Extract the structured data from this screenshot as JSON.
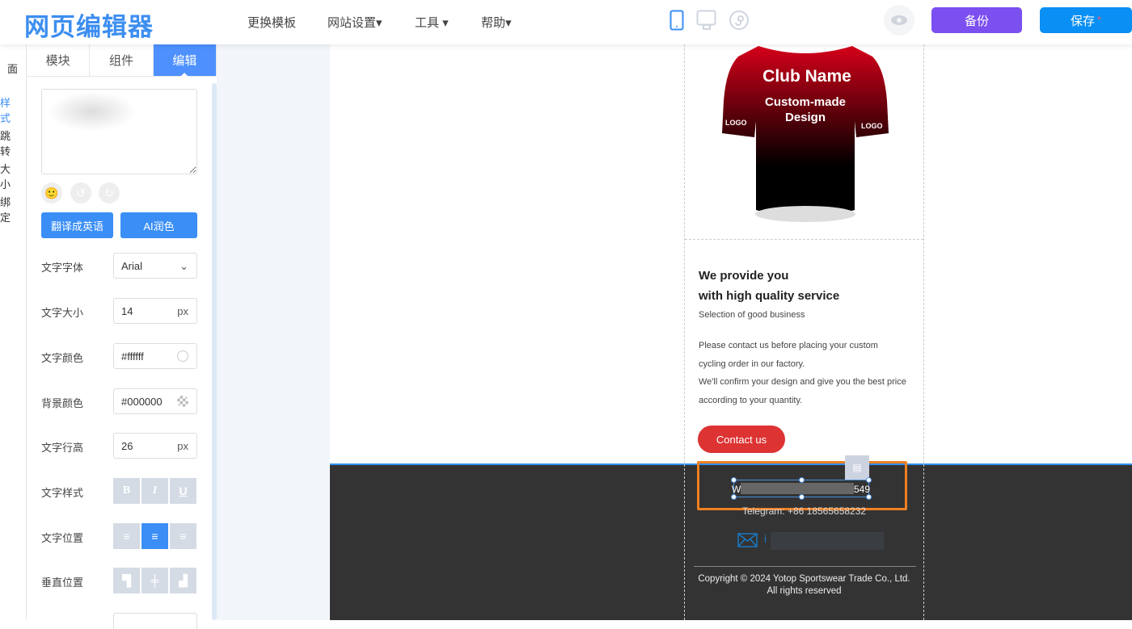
{
  "header": {
    "logo": "网页编辑器",
    "nav": [
      "更换模板",
      "网站设置▾",
      "工具 ▾",
      "帮助▾"
    ],
    "backup": "备份",
    "save": "保存",
    "save_dot": "*"
  },
  "leftnav": [
    "面",
    "样式",
    "跳转",
    "大小",
    "绑定"
  ],
  "tabs": [
    "模块",
    "组件",
    "编辑"
  ],
  "panel": {
    "translate": "翻译成英语",
    "ai": "AI润色",
    "rows": [
      {
        "label": "文字字体",
        "value": "Arial"
      },
      {
        "label": "文字大小",
        "value": "14",
        "suffix": "px"
      },
      {
        "label": "文字颜色",
        "value": "#ffffff"
      },
      {
        "label": "背景颜色",
        "value": "#000000"
      },
      {
        "label": "文字行高",
        "value": "26",
        "suffix": "px"
      },
      {
        "label": "文字样式",
        "buttons": [
          "B",
          "I",
          "U"
        ]
      },
      {
        "label": "文字位置",
        "buttons": [
          "≡",
          "≡",
          "≡"
        ]
      },
      {
        "label": "垂直位置",
        "buttons": [
          "▜",
          "╪",
          "▟"
        ]
      }
    ]
  },
  "jersey": {
    "club": "Club Name",
    "design1": "Custom-made",
    "design2": "Design",
    "logo": "LOGO"
  },
  "content": {
    "h1": "We provide you",
    "h2": "with high quality service",
    "sub": "Selection of good business",
    "p1": "Please contact us before placing your custom",
    "p2": "cycling order in our factory.",
    "p3": "We'll confirm your design and give you the best price",
    "p4": "according to your quantity.",
    "cta": "Contact us"
  },
  "footer": {
    "whatsapp_start": "W",
    "whatsapp_end": "549",
    "telegram": "Telegram: +86 18565658232",
    "email_start": "i",
    "copyright": "Copyright © 2024 Yotop Sportswear Trade Co., Ltd.",
    "rights": "All rights reserved"
  },
  "colors": {
    "accent": "#3a8ef5",
    "backup": "#7b4ff0",
    "save": "#0a8ff5",
    "highlight": "#f08020",
    "cta": "#d33"
  }
}
